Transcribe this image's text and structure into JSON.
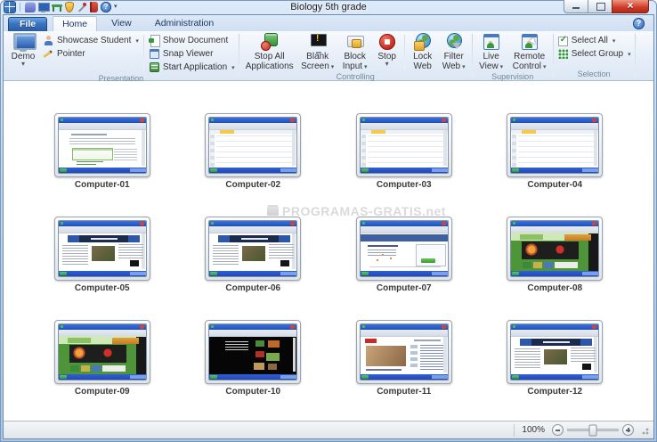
{
  "window": {
    "title": "Biology 5th grade"
  },
  "tabs": {
    "file": "File",
    "home": "Home",
    "view": "View",
    "administration": "Administration"
  },
  "quick_access_icons": [
    "app-grid",
    "chat",
    "student-monitors",
    "classroom-desk",
    "shield",
    "tools",
    "exit-journal",
    "help",
    "customize-dropdown"
  ],
  "ribbon": {
    "presentation": {
      "label": "Presentation",
      "demo": "Demo",
      "showcase_student": "Showcase Student",
      "pointer": "Pointer",
      "show_document": "Show Document",
      "snap_viewer": "Snap Viewer",
      "start_application": "Start Application"
    },
    "controlling": {
      "label": "Controlling",
      "stop_all": "Stop All Applications",
      "blank_screen": "Blank Screen",
      "block_input": "Block Input",
      "stop": "Stop",
      "lock_web": "Lock Web",
      "filter_web": "Filter Web"
    },
    "supervision": {
      "label": "Supervision",
      "live_view": "Live View",
      "remote_control": "Remote Control"
    },
    "selection": {
      "label": "Selection",
      "select_all": "Select All",
      "select_group": "Select Group"
    }
  },
  "computers": [
    {
      "name": "Computer-01",
      "screen": "word document"
    },
    {
      "name": "Computer-02",
      "screen": "spreadsheet"
    },
    {
      "name": "Computer-03",
      "screen": "spreadsheet"
    },
    {
      "name": "Computer-04",
      "screen": "spreadsheet"
    },
    {
      "name": "Computer-05",
      "screen": "news website"
    },
    {
      "name": "Computer-06",
      "screen": "news website"
    },
    {
      "name": "Computer-07",
      "screen": "login page"
    },
    {
      "name": "Computer-08",
      "screen": "games website"
    },
    {
      "name": "Computer-09",
      "screen": "games website"
    },
    {
      "name": "Computer-10",
      "screen": "dark video gallery"
    },
    {
      "name": "Computer-11",
      "screen": "video page"
    },
    {
      "name": "Computer-12",
      "screen": "news website"
    }
  ],
  "watermark": "PROGRAMAS-GRATIS.net",
  "status_bar": {
    "zoom_level": "100%"
  },
  "colors": {
    "file_button": "#3a74c0",
    "close_button": "#cf3a28",
    "ribbon_bg": "#e6eef8",
    "watermark": "#dadada",
    "mini_titlebar": "#2a5cc8"
  }
}
